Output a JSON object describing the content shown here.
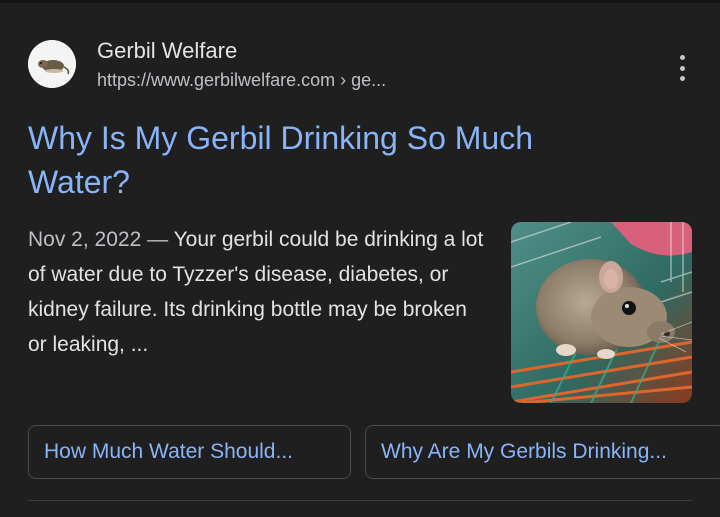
{
  "result": {
    "site_name": "Gerbil Welfare",
    "site_url": "https://www.gerbilwelfare.com › ge...",
    "favicon_icon": "gerbil-logo-icon",
    "more_icon": "more-vert-icon",
    "title": "Why Is My Gerbil Drinking So Much Water?",
    "date": "Nov 2, 2022",
    "separator": "—",
    "snippet": "Your gerbil could be drinking a lot of water due to Tyzzer's disease, diabetes, or kidney failure. Its drinking bottle may be broken or leaking, ...",
    "thumbnail": "gerbil-in-cage-photo"
  },
  "related_chips": [
    {
      "label": "How Much Water Should..."
    },
    {
      "label": "Why Are My Gerbils Drinking..."
    }
  ],
  "colors": {
    "background": "#1f1f1f",
    "link": "#8ab4f8",
    "text": "#e3e3e3",
    "muted": "#bdc1c6",
    "chip_border": "#4b4b4b"
  }
}
